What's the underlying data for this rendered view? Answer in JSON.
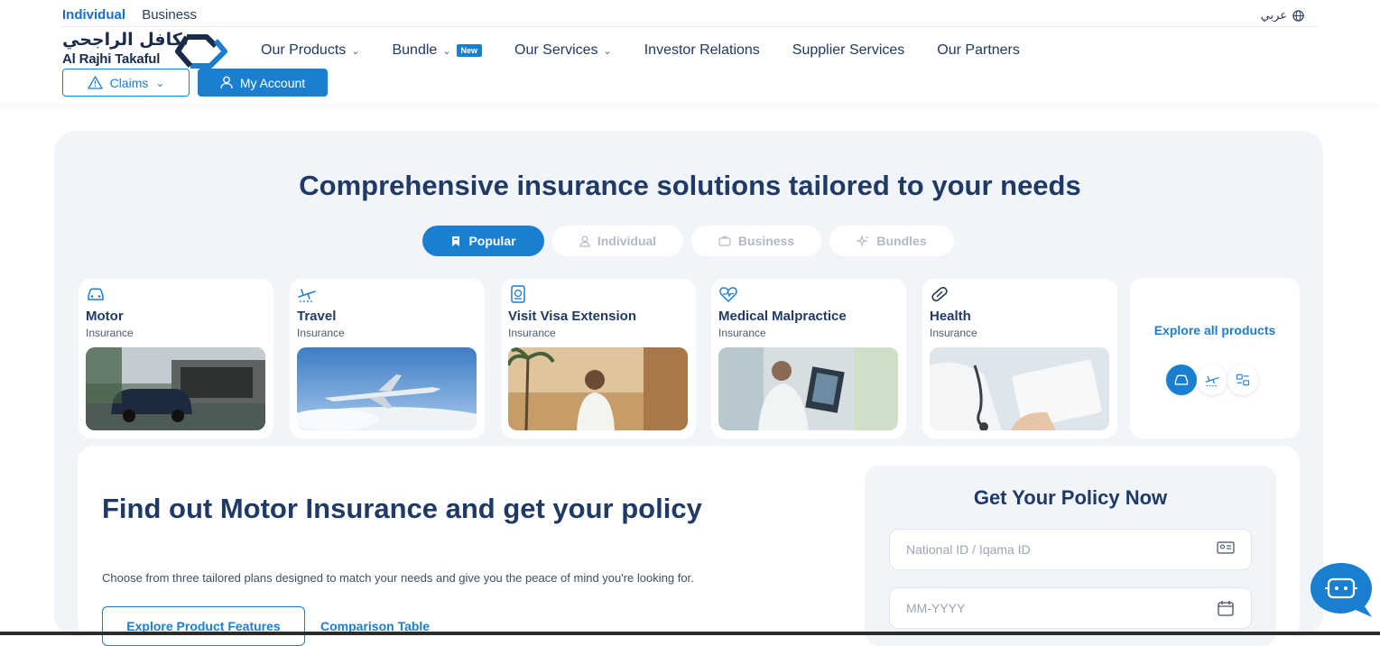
{
  "header": {
    "segments": [
      "Individual",
      "Business"
    ],
    "language": "عربي",
    "logo": {
      "arabic": "تكافل الراجحي",
      "english": "Al Rajhi Takaful"
    },
    "nav": [
      {
        "label": "Our Products",
        "dropdown": true
      },
      {
        "label": "Bundle",
        "dropdown": true,
        "badge": "New"
      },
      {
        "label": "Our Services",
        "dropdown": true
      },
      {
        "label": "Investor Relations"
      },
      {
        "label": "Supplier Services"
      },
      {
        "label": "Our Partners"
      }
    ],
    "claims": "Claims",
    "account": "My Account"
  },
  "main": {
    "headline": "Comprehensive insurance solutions tailored to your needs",
    "tabs": [
      "Popular",
      "Individual",
      "Business",
      "Bundles"
    ],
    "active_tab": "Popular",
    "cards": [
      {
        "title": "Motor",
        "subtitle": "Insurance",
        "icon": "car-icon"
      },
      {
        "title": "Travel",
        "subtitle": "Insurance",
        "icon": "plane-icon"
      },
      {
        "title": "Visit Visa Extension",
        "subtitle": "Insurance",
        "icon": "passport-icon"
      },
      {
        "title": "Medical Malpractice",
        "subtitle": "Insurance",
        "icon": "heartbeat-icon"
      },
      {
        "title": "Health",
        "subtitle": "Insurance",
        "icon": "pill-icon"
      }
    ],
    "explore_all": "Explore all products"
  },
  "motor_section": {
    "title": "Find out Motor Insurance and get your policy",
    "description": "Choose from three tailored plans designed to match your needs and give you the peace of mind you're looking for.",
    "explore_button": "Explore Product Features",
    "compare_link": "Comparison Table"
  },
  "policy_form": {
    "title": "Get Your Policy Now",
    "id_placeholder": "National ID / Iqama ID",
    "date_placeholder": "MM-YYYY"
  },
  "colors": {
    "primary": "#1a7fd1",
    "navy": "#1f3a66",
    "panel": "#f1f4f8"
  }
}
